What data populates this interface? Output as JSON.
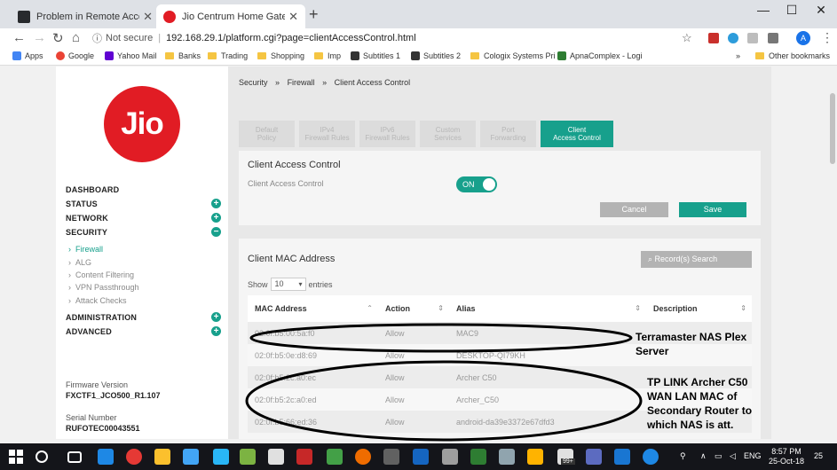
{
  "browser": {
    "tabs": [
      {
        "title": "Problem in Remote Access - Plex"
      },
      {
        "title": "Jio Centrum Home Gateway :"
      }
    ],
    "not_secure": "Not secure",
    "url": "192.168.29.1/platform.cgi?page=clientAccessControl.html",
    "avatar": "A",
    "bookmarks": [
      "Apps",
      "Google",
      "Yahoo Mail",
      "Banks",
      "Trading",
      "Shopping",
      "Imp",
      "Subtitles 1",
      "Subtitles 2",
      "Cologix Systems Pri",
      "ApnaComplex - Logi"
    ],
    "other_bookmarks": "Other bookmarks",
    "more": "»"
  },
  "sidebar": {
    "logo": "Jio",
    "sections": [
      {
        "label": "DASHBOARD"
      },
      {
        "label": "STATUS",
        "icon": "+"
      },
      {
        "label": "NETWORK",
        "icon": "+"
      },
      {
        "label": "SECURITY",
        "icon": "−"
      }
    ],
    "security_items": [
      "Firewall",
      "ALG",
      "Content Filtering",
      "VPN Passthrough",
      "Attack Checks"
    ],
    "lower_sections": [
      {
        "label": "ADMINISTRATION",
        "icon": "+"
      },
      {
        "label": "ADVANCED",
        "icon": "+"
      }
    ],
    "firmware_label": "Firmware Version",
    "firmware_value": "FXCTF1_JCO500_R1.107",
    "serial_label": "Serial Number",
    "serial_value": "RUFOTEC00043551"
  },
  "main": {
    "breadcrumb": [
      "Security",
      "»",
      "Firewall",
      "»",
      "Client Access Control"
    ],
    "tabs": [
      {
        "l1": "Default",
        "l2": "Policy"
      },
      {
        "l1": "IPv4",
        "l2": "Firewall Rules"
      },
      {
        "l1": "IPv6",
        "l2": "Firewall Rules"
      },
      {
        "l1": "Custom",
        "l2": "Services"
      },
      {
        "l1": "Port",
        "l2": "Forwarding"
      },
      {
        "l1": "Client",
        "l2": "Access Control"
      }
    ],
    "cac_title": "Client Access Control",
    "cac_label": "Client Access Control",
    "toggle": "ON",
    "cancel": "Cancel",
    "save": "Save",
    "mac_title": "Client MAC Address",
    "search_placeholder": "Record(s) Search",
    "show_label": "Show",
    "entries_value": "10",
    "entries_label": "entries",
    "columns": [
      "MAC Address",
      "Action",
      "Alias",
      "Description"
    ],
    "rows": [
      {
        "mac": "02:0f:b5:00:5a:f0",
        "action": "Allow",
        "alias": "MAC9",
        "desc": ""
      },
      {
        "mac": "02:0f:b5:0e:d8:69",
        "action": "Allow",
        "alias": "DESKTOP-QI79KH",
        "desc": ""
      },
      {
        "mac": "02:0f:b5:2c:a0:ec",
        "action": "Allow",
        "alias": "Archer C50",
        "desc": ""
      },
      {
        "mac": "02:0f:b5:2c:a0:ed",
        "action": "Allow",
        "alias": "Archer_C50",
        "desc": ""
      },
      {
        "mac": "02:0f:b5:66:ed:36",
        "action": "Allow",
        "alias": "android-da39e3372e67dfd3",
        "desc": ""
      }
    ]
  },
  "annotations": {
    "note1": [
      "Terramaster NAS Plex",
      "Server"
    ],
    "note2": [
      "TP LINK Archer C50",
      "WAN LAN MAC of",
      "Secondary Router to",
      "which NAS is att."
    ]
  },
  "taskbar": {
    "lang": "ENG",
    "time": "8:57 PM",
    "date": "25-Oct-18",
    "notif": "25",
    "badge": "99+"
  },
  "colors": {
    "accent": "#17a08c",
    "jio_red": "#e11c24"
  }
}
